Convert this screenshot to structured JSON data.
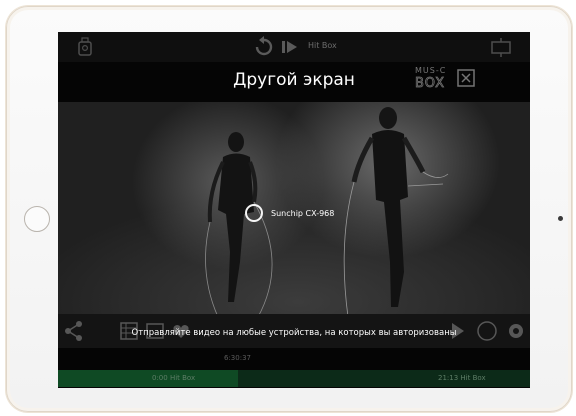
{
  "toolbar": {
    "title": "Hit Box"
  },
  "modal": {
    "title": "Другой экран",
    "device_name": "Sunchip CX-968",
    "caption": "Отправляйте видео на любые устройства, на которых вы авторизованы"
  },
  "logo": {
    "line1": "MUS-C",
    "line2": "BOX"
  },
  "timeline": {
    "current_time": "6:30:37",
    "start_label": "0:00 Hit Box",
    "end_label": "21:13 Hit Box"
  },
  "colors": {
    "track_bg": "#0c2a18",
    "track_progress": "#0f4a24"
  }
}
